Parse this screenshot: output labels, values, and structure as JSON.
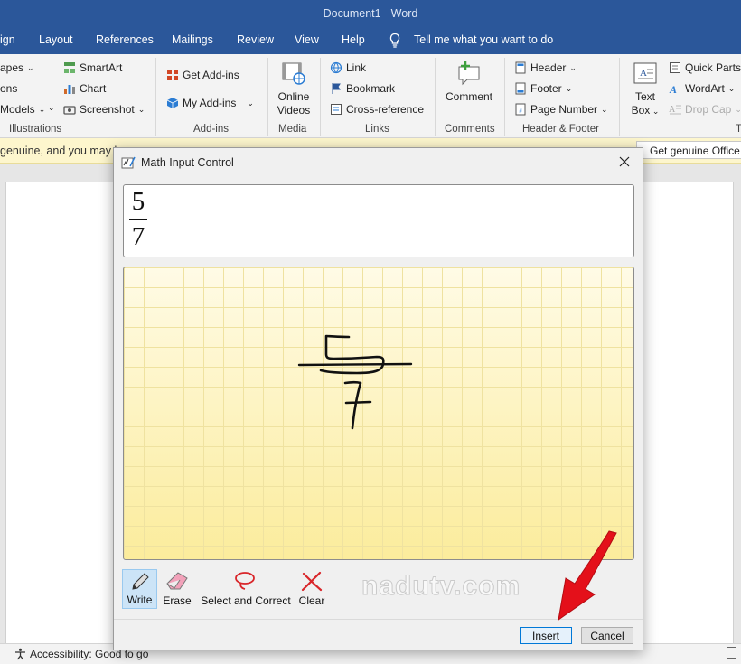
{
  "window": {
    "title": "Document1 - Word"
  },
  "menu": {
    "tabs": [
      "ign",
      "Layout",
      "References",
      "Mailings",
      "Review",
      "View",
      "Help"
    ],
    "tell_me": "Tell me what you want to do"
  },
  "ribbon": {
    "illustrations": {
      "items": [
        "apes",
        "ons",
        "Models"
      ],
      "smartart": "SmartArt",
      "chart": "Chart",
      "screenshot": "Screenshot",
      "group": "Illustrations"
    },
    "addins": {
      "get": "Get Add-ins",
      "my": "My Add-ins",
      "group": "Add-ins"
    },
    "media": {
      "line1": "Online",
      "line2": "Videos",
      "group": "Media"
    },
    "links": {
      "link": "Link",
      "bookmark": "Bookmark",
      "cross": "Cross-reference",
      "group": "Links"
    },
    "comments": {
      "comment": "Comment",
      "group": "Comments"
    },
    "header_footer": {
      "header": "Header",
      "footer": "Footer",
      "page_number": "Page Number",
      "group": "Header & Footer"
    },
    "text": {
      "line1": "Text",
      "line2": "Box",
      "quick_parts": "Quick Parts",
      "wordart": "WordArt",
      "drop_cap": "Drop Cap",
      "group": "T"
    }
  },
  "infobar": {
    "message": "genuine, and you may be",
    "button": "Get genuine Office"
  },
  "status": {
    "accessibility": "Accessibility: Good to go"
  },
  "dialog": {
    "title": "Math Input Control",
    "preview": {
      "numerator": "5",
      "denominator": "7"
    },
    "tools": [
      {
        "id": "write",
        "label": "Write"
      },
      {
        "id": "erase",
        "label": "Erase"
      },
      {
        "id": "select",
        "label": "Select and Correct"
      },
      {
        "id": "clear",
        "label": "Clear"
      }
    ],
    "insert_label": "Insert",
    "cancel_label": "Cancel"
  },
  "watermark": "nadutv.com",
  "colors": {
    "title_bar": "#2b579a",
    "canvas": "#fdf6c4",
    "arrow": "#e4101a",
    "info_bar": "#fdf6cd"
  }
}
